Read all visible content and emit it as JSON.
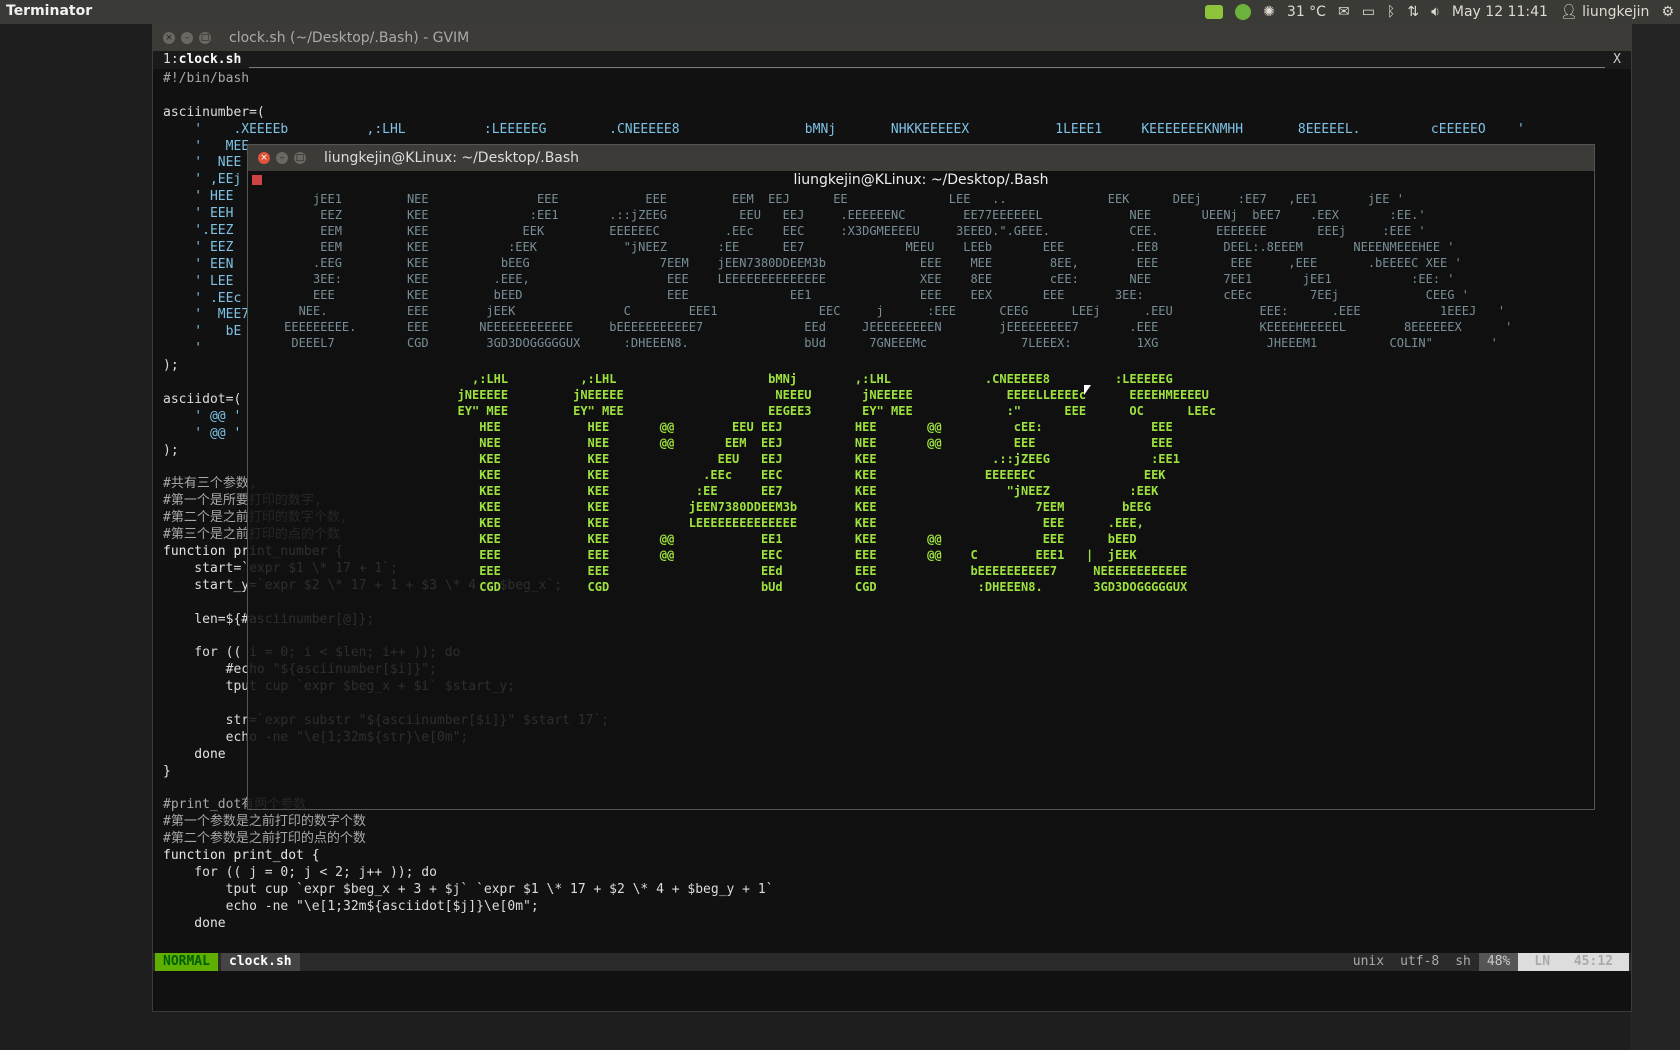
{
  "panel": {
    "app_name": "Terminator",
    "temperature": "31 °C",
    "datetime": "May 12 11:41",
    "user": "liungkejin"
  },
  "gvim": {
    "title": "clock.sh (~/Desktop/.Bash) - GVIM",
    "tab_number": "1:",
    "tab_name": "clock.sh",
    "tab_close": "X",
    "status": {
      "mode": "NORMAL",
      "file": "clock.sh",
      "format": "unix",
      "encoding": "utf-8",
      "filetype": "sh",
      "percent": "48%",
      "ln_label": "LN",
      "position": "45:12"
    },
    "code_lines": [
      "#!/bin/bash",
      "",
      "asciinumber=(",
      "    '    .XEEEEb          ,:LHL          :LEEEEEG        .CNEEEEE8                bMNj       NHKKEEEEEX           1LEEE1     KEEEEEEEKNMHH       8EEEEEL.         cEEEEEO    '",
      "    '   MEE",
      "    '  NEE",
      "    ' ,EEj",
      "    ' HEE",
      "    ' EEH",
      "    '.EEZ",
      "    ' EEZ",
      "    ' EEN",
      "    ' LEE",
      "    ' .EEc",
      "    '  MEE7",
      "    '   bE",
      "    '    ",
      ");",
      "",
      "asciidot=(",
      "    ' @@ '",
      "    ' @@ '",
      ");",
      "",
      "#共有三个参数,",
      "#第一个是所要打印的数字,",
      "#第二个是之前打印的数字个数,",
      "#第三个是之前打印的点的个数",
      "function print_number {",
      "    start=`expr $1 \\* 17 + 1`;",
      "    start_y=`expr $2 \\* 17 + 1 + $3 \\* 4 + $beg_x`;",
      "",
      "    len=${#asciinumber[@]};",
      "",
      "    for (( i = 0; i < $len; i++ )); do",
      "        #echo \"${asciinumber[$i]}\";",
      "        tput cup `expr $beg_x + $i` $start_y;",
      "",
      "        str=`expr substr \"${asciinumber[$i]}\" $start 17`;",
      "        echo -ne \"\\e[1;32m${str}\\e[0m\";",
      "    done",
      "}",
      "",
      "#print_dot有两个参数",
      "#第一个参数是之前打印的数字个数",
      "#第二个参数是之前打印的点的个数",
      "function print_dot {",
      "    for (( j = 0; j < 2; j++ )); do",
      "        tput cup `expr $beg_x + 3 + $j` `expr $1 \\* 17 + $2 \\* 4 + $beg_y + 1`",
      "        echo -ne \"\\e[1;32m${asciidot[$j]}\\e[0m\";",
      "    done"
    ]
  },
  "terminator": {
    "title": "liungkejin@KLinux: ~/Desktop/.Bash",
    "inner_title": "liungkejin@KLinux: ~/Desktop/.Bash",
    "faded_lines": [
      "         jEE1         NEE               EEE            EEE         EEM  EEJ      EE              LEE   ..              EEK      DEEj     :EE7   ,EE1       jEE '",
      "          EEZ         KEE              :EE1       .::jZEEG          EEU   EEJ     .EEEEEENC        EE77EEEEEEL            NEE       UEENj  bEE7    .EEX       :EE.'",
      "          EEM         KEE             EEK         EEEEEEC         .EEc    EEC     :X3DGMEEEEU     3EEED.\".GEEE.           CEE.        EEEEEEE       EEEj     :EEE '",
      "          EEM         KEE           :EEK            \"jNEEZ       :EE      EE7              MEEU    LEEb       EEE         .EE8         DEEL:.8EEEM       NEEENMEEEHEE '",
      "         .EEG         KEE          bEEG                  7EEM    jEEN7380DDEEM3b             EEE    MEE        8EE,        EEE          EEE     ,EEE       .bEEEEC XEE '",
      "         3EE:         KEE         .EEE,                   EEE    LEEEEEEEEEEEEEE             XEE    8EE        cEE:       NEE          7EE1       jEE1           :EE: '",
      "         EEE          KEE         bEED                    EEE              EE1               EEE    EEX       EEE       3EE:           cEEc        7EEj            CEEG '",
      "       NEE.           EEE        jEEK               C        EEE1              EEC     j      :EEE      CEEG      LEEj      .EEU            EEE:      .EEE           1EEEJ   '",
      "     EEEEEEEEE.       EEE       NEEEEEEEEEEEE     bEEEEEEEEEEE7              EEd     JEEEEEEEEEN        jEEEEEEEEE7       .EEE              KEEEEHEEEEEL        8EEEEEEX      '",
      "      DEEEL7          CGD        3GD3DOGGGGGUX      :DHEEEN8.                bUd      7GNEEEMc             7LEEEX:         1XG               JHEEEM1          COLIN\"        '"
    ],
    "clock_lines": [
      "                               ,:LHL          ,:LHL                     bMNj        ,:LHL             .CNEEEEE8         :LEEEEEG",
      "                             jNEEEEE         jNEEEEE                     NEEEU       jNEEEEE             EEEELLEEEEc      EEEEHMEEEEU",
      "                             EY\" MEE         EY\" MEE                    EEGEE3       EY\" MEE             :\"      EEE      OC      LEEc",
      "                                HEE            HEE       @@        EEU EEJ          HEE       @@          cEE:               EEE",
      "                                NEE            NEE       @@       EEM  EEJ          NEE       @@          EEE                EEE",
      "                                KEE            KEE               EEU   EEJ          KEE                .::jZEEG              :EE1",
      "                                KEE            KEE             .EEc    EEC          KEE               EEEEEEC               EEK",
      "                                KEE            KEE            :EE      EE7          KEE                  \"jNEEZ           :EEK",
      "                                KEE            KEE           jEEN7380DDEEM3b        KEE                      7EEM        bEEG",
      "                                KEE            KEE           LEEEEEEEEEEEEEE        KEE                       EEE      .EEE,",
      "                                KEE            KEE       @@            EE1          KEE       @@              EEE      bEED",
      "                                EEE            EEE       @@            EEC          EEE       @@    C        EEE1   |  jEEK",
      "                                EEE            EEE                     EEd          EEE             bEEEEEEEEEE7     NEEEEEEEEEEEE",
      "                                CGD            CGD                     bUd          CGD              :DHEEEN8.       3GD3DOGGGGGUX"
    ]
  }
}
